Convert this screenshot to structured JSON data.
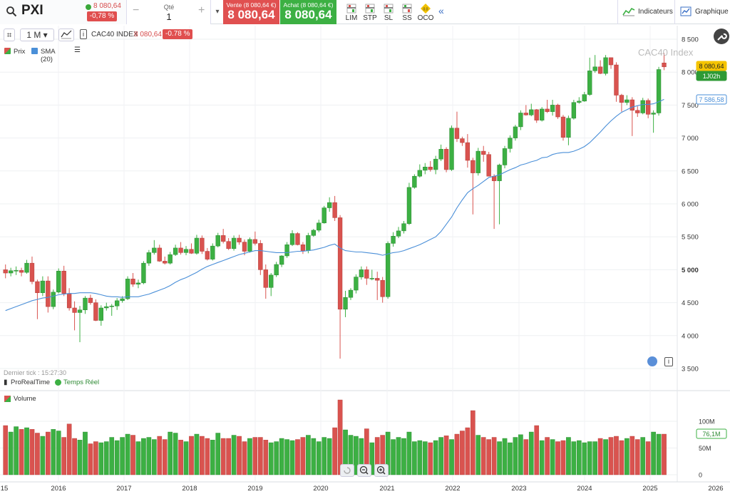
{
  "toolbar": {
    "symbol": "PXI",
    "price": "8 080,64",
    "change_pct": "-0,78 %",
    "qty_label": "Qté",
    "qty_value": "1",
    "qty_minus": "−",
    "qty_plus": "+",
    "sell_label": "Vente (8 080,64 €)",
    "sell_price": "8 080,64",
    "buy_label": "Achat (8 080,64 €)",
    "buy_price": "8 080,64",
    "order_tools": [
      "LIM",
      "STP",
      "SL",
      "SS",
      "OCO"
    ],
    "oco_badge": "0.0",
    "indicators_label": "Indicateurs",
    "chart_label": "Graphique"
  },
  "chart_toolbar": {
    "period": "1 M",
    "instrument": "CAC40 INDEX",
    "price": "8 080,64",
    "change": "-0.78 %",
    "watermark": "CAC40 Index"
  },
  "legend": {
    "price_label": "Prix",
    "sma_label": "SMA (20)",
    "volume_label": "Volume"
  },
  "status": {
    "last_tick": "Dernier tick : 15:27:30",
    "source": "ProRealTime",
    "realtime": "Temps Réel"
  },
  "badges": {
    "price": "8 080,64",
    "countdown": "1J02h",
    "sma": "7 586,58",
    "volume": "76,1M"
  },
  "colors": {
    "up": "#3cb043",
    "down": "#d9534f",
    "sma": "#4a8fd8",
    "price_badge": "#f5c400",
    "countdown_badge": "#2e9a35"
  },
  "chart_data": {
    "type": "candlestick",
    "period": "1 M",
    "series": [
      {
        "name": "CAC40 INDEX",
        "kind": "ohlc",
        "values": "opens/highs/lows/closes"
      },
      {
        "name": "SMA (20)",
        "kind": "line"
      },
      {
        "name": "Volume",
        "kind": "bar"
      }
    ],
    "x_tick_labels": [
      "15",
      "2016",
      "2017",
      "2018",
      "2019",
      "2020",
      "2021",
      "2022",
      "2023",
      "2024",
      "2025",
      "2026"
    ],
    "y_tick_labels": [
      "3 500",
      "4 000",
      "4 500",
      "5 000",
      "5 500",
      "6 000",
      "6 500",
      "7 000",
      "7 500",
      "8 000",
      "8 500"
    ],
    "ylim": [
      3300,
      8600
    ],
    "volume_tick_labels": [
      "0",
      "50M",
      "100M"
    ],
    "volume_ylim": [
      0,
      120
    ],
    "start": "2015-01",
    "closes": [
      4950,
      4985,
      4990,
      4960,
      5100,
      4820,
      4650,
      4830,
      4440,
      4660,
      4980,
      4640,
      4420,
      4350,
      4390,
      4570,
      4500,
      4230,
      4420,
      4440,
      4450,
      4530,
      4560,
      4860,
      4780,
      4800,
      5100,
      5260,
      5330,
      5130,
      5100,
      5230,
      5330,
      5260,
      5310,
      5250,
      5480,
      5280,
      5160,
      5360,
      5520,
      5430,
      5320,
      5480,
      5420,
      5280,
      5460,
      5400,
      5000,
      4730,
      4920,
      5080,
      5210,
      5380,
      5550,
      5380,
      5290,
      5520,
      5600,
      5710,
      5940,
      6020,
      5790,
      4400,
      4580,
      4690,
      4890,
      5000,
      4870,
      4870,
      4840,
      4590,
      5400,
      5510,
      5590,
      5700,
      6250,
      6420,
      6510,
      6560,
      6520,
      6680,
      6830,
      6520,
      7150,
      6990,
      6930,
      6660,
      6470,
      6800,
      6750,
      6420,
      6350,
      6590,
      6840,
      7000,
      7170,
      7380,
      7350,
      7430,
      7270,
      7440,
      7400,
      7500,
      7320,
      7010,
      7300,
      7540,
      7560,
      7660,
      8020,
      8080,
      7980,
      8220,
      8110,
      7650,
      7540,
      7580,
      7420,
      7380,
      7570,
      7360,
      7380,
      8040,
      8080
    ],
    "opens": [
      5000,
      4950,
      4985,
      4990,
      4960,
      5100,
      4820,
      4650,
      4830,
      4440,
      4660,
      4980,
      4640,
      4420,
      4350,
      4390,
      4570,
      4500,
      4230,
      4420,
      4440,
      4450,
      4530,
      4560,
      4860,
      4780,
      4800,
      5100,
      5260,
      5330,
      5130,
      5100,
      5230,
      5330,
      5260,
      5310,
      5250,
      5480,
      5280,
      5160,
      5360,
      5520,
      5430,
      5320,
      5480,
      5420,
      5280,
      5460,
      5400,
      5000,
      4730,
      4920,
      5080,
      5210,
      5380,
      5550,
      5380,
      5290,
      5520,
      5600,
      5710,
      5940,
      6020,
      5790,
      4400,
      4580,
      4690,
      4890,
      5000,
      4870,
      4870,
      4840,
      4590,
      5400,
      5510,
      5590,
      5700,
      6250,
      6420,
      6510,
      6560,
      6520,
      6680,
      6830,
      6520,
      7150,
      6990,
      6930,
      6660,
      6470,
      6800,
      6750,
      6420,
      6350,
      6590,
      6840,
      7000,
      7170,
      7380,
      7350,
      7430,
      7270,
      7440,
      7400,
      7500,
      7320,
      7010,
      7300,
      7540,
      7560,
      7660,
      8020,
      8080,
      7980,
      8220,
      8110,
      7650,
      7540,
      7580,
      7420,
      7380,
      7570,
      7360,
      7380,
      8140
    ],
    "highs": [
      5080,
      5030,
      5050,
      5030,
      5150,
      5200,
      4850,
      4900,
      4900,
      4700,
      5020,
      5060,
      4720,
      4520,
      4450,
      4600,
      4620,
      4550,
      4460,
      4500,
      4480,
      4570,
      4600,
      4900,
      4950,
      4850,
      5130,
      5300,
      5450,
      5380,
      5200,
      5270,
      5380,
      5420,
      5360,
      5400,
      5530,
      5520,
      5330,
      5400,
      5560,
      5620,
      5480,
      5520,
      5530,
      5460,
      5490,
      5580,
      5450,
      5080,
      4950,
      5120,
      5220,
      5420,
      5600,
      5570,
      5420,
      5560,
      5620,
      5760,
      5970,
      6100,
      6120,
      5830,
      4680,
      4720,
      4930,
      5050,
      5050,
      5000,
      4970,
      4890,
      5430,
      5570,
      5650,
      5740,
      6320,
      6450,
      6600,
      6620,
      6650,
      6730,
      6900,
      6860,
      7190,
      7400,
      7020,
      7060,
      6700,
      6850,
      6880,
      6790,
      6450,
      6610,
      6880,
      7040,
      7200,
      7420,
      7500,
      7520,
      7440,
      7470,
      7580,
      7580,
      7520,
      7350,
      7340,
      7580,
      7620,
      7700,
      8220,
      8260,
      8180,
      8260,
      8220,
      8150,
      7670,
      7650,
      7620,
      7480,
      7610,
      7600,
      7420,
      8080,
      8290
    ],
    "lows": [
      4870,
      4900,
      4920,
      4900,
      4940,
      4780,
      4250,
      4600,
      4350,
      4400,
      4640,
      4600,
      4380,
      4080,
      3900,
      4330,
      4470,
      4220,
      4150,
      4380,
      4300,
      4390,
      4500,
      4540,
      4740,
      4720,
      4780,
      5060,
      5230,
      5120,
      5080,
      5080,
      5210,
      5230,
      5220,
      5240,
      5230,
      5240,
      5140,
      5140,
      5340,
      5400,
      5300,
      5290,
      5380,
      5220,
      5260,
      5370,
      4920,
      4560,
      4600,
      4890,
      5040,
      5180,
      5360,
      5370,
      5240,
      5250,
      5500,
      5570,
      5700,
      5880,
      5740,
      3650,
      4280,
      4540,
      4640,
      4850,
      4770,
      4840,
      4540,
      4500,
      4560,
      5350,
      5480,
      5550,
      5680,
      6230,
      6400,
      6450,
      6490,
      6450,
      6650,
      6480,
      6500,
      6940,
      6880,
      6550,
      5840,
      6430,
      6640,
      6420,
      5620,
      5690,
      6540,
      6780,
      6960,
      7120,
      7340,
      7330,
      7230,
      7250,
      7380,
      7340,
      7290,
      6960,
      6890,
      7280,
      7520,
      7550,
      7640,
      7990,
      7970,
      7950,
      8050,
      7550,
      7400,
      7500,
      7030,
      7320,
      7360,
      7300,
      7080,
      7340,
      8030
    ],
    "sma": [
      4380,
      4410,
      4440,
      4470,
      4500,
      4530,
      4550,
      4570,
      4580,
      4600,
      4620,
      4630,
      4640,
      4640,
      4650,
      4650,
      4650,
      4640,
      4620,
      4600,
      4590,
      4590,
      4580,
      4590,
      4590,
      4590,
      4610,
      4630,
      4660,
      4690,
      4720,
      4760,
      4810,
      4850,
      4880,
      4920,
      4960,
      5010,
      5050,
      5080,
      5110,
      5140,
      5170,
      5200,
      5230,
      5250,
      5270,
      5290,
      5290,
      5280,
      5270,
      5260,
      5260,
      5260,
      5270,
      5280,
      5280,
      5290,
      5300,
      5320,
      5340,
      5370,
      5390,
      5330,
      5290,
      5280,
      5270,
      5270,
      5260,
      5250,
      5240,
      5220,
      5240,
      5260,
      5270,
      5290,
      5320,
      5350,
      5380,
      5420,
      5460,
      5500,
      5580,
      5690,
      5800,
      5940,
      6060,
      6170,
      6230,
      6280,
      6340,
      6400,
      6420,
      6440,
      6480,
      6520,
      6550,
      6590,
      6610,
      6640,
      6660,
      6700,
      6710,
      6750,
      6770,
      6780,
      6780,
      6800,
      6830,
      6870,
      6930,
      7010,
      7090,
      7180,
      7260,
      7330,
      7390,
      7430,
      7470,
      7490,
      7510,
      7510,
      7520,
      7550,
      7587
    ],
    "volume": [
      92,
      80,
      90,
      85,
      88,
      85,
      78,
      72,
      80,
      85,
      82,
      70,
      95,
      68,
      65,
      80,
      58,
      62,
      60,
      62,
      70,
      64,
      70,
      76,
      74,
      62,
      68,
      70,
      66,
      72,
      66,
      80,
      78,
      65,
      62,
      72,
      76,
      72,
      68,
      65,
      78,
      68,
      68,
      74,
      72,
      62,
      68,
      70,
      70,
      65,
      60,
      62,
      68,
      66,
      64,
      66,
      70,
      74,
      68,
      62,
      70,
      68,
      88,
      140,
      84,
      74,
      72,
      68,
      86,
      60,
      70,
      74,
      80,
      66,
      70,
      68,
      80,
      62,
      64,
      62,
      60,
      64,
      70,
      73,
      66,
      76,
      82,
      88,
      120,
      74,
      70,
      66,
      70,
      62,
      68,
      60,
      70,
      75,
      66,
      80,
      92,
      64,
      70,
      66,
      62,
      64,
      70,
      62,
      64,
      60,
      62,
      62,
      68,
      66,
      70,
      72,
      64,
      68,
      72,
      66,
      70,
      62,
      80,
      76,
      76
    ]
  }
}
